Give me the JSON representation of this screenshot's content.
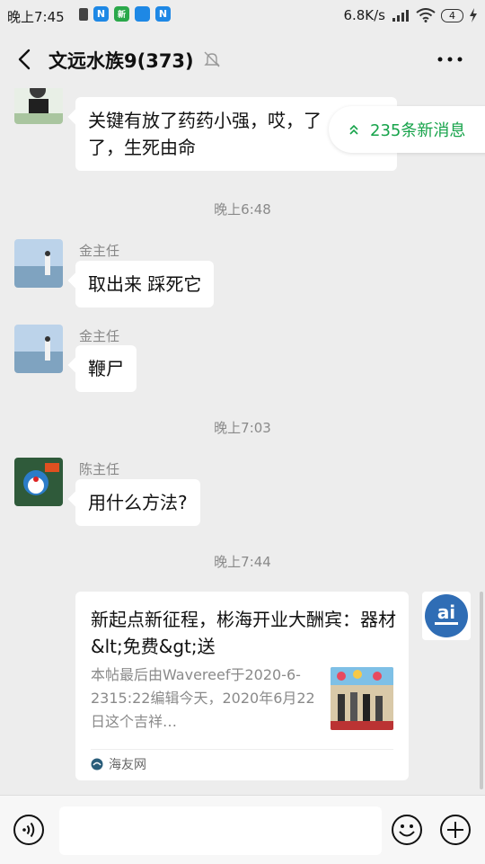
{
  "status_bar": {
    "time": "晚上7:45",
    "app_badges": [
      {
        "label": "N",
        "color": "#1e88e5"
      },
      {
        "label": "新",
        "color": "#2aa84a"
      },
      {
        "label": "",
        "color": "#1e88e5"
      },
      {
        "label": "N",
        "color": "#1e88e5"
      }
    ],
    "speed": "6.8K/s",
    "battery": "4"
  },
  "header": {
    "title": "文远水族9(373)",
    "icons": [
      "back-icon",
      "mute-bell-icon",
      "more-icon"
    ]
  },
  "new_messages": {
    "label": "235条新消息",
    "color": "#16a34a"
  },
  "messages": [
    {
      "sender": "",
      "text_lines": [
        "关键有放了药药小强，哎，了",
        "了，生死由命"
      ]
    },
    {
      "sender": "金主任",
      "text": "取出来 踩死它"
    },
    {
      "sender": "金主任",
      "text": "鞭尸"
    },
    {
      "sender": "陈主任",
      "text": "用什么方法?"
    }
  ],
  "time_separators": [
    "晚上6:48",
    "晚上7:03",
    "晚上7:44"
  ],
  "link_card": {
    "title": "新起点新征程，彬海开业大酬宾：器材&lt;免费&gt;送",
    "desc": "本帖最后由Wavereef于2020-6-2315:22编辑今天，2020年6月22日这个吉祥…",
    "source": "海友网",
    "avatar_text": "ai"
  },
  "bottom_bar": {
    "icons": [
      "voice-icon",
      "emoji-icon",
      "plus-icon"
    ]
  }
}
